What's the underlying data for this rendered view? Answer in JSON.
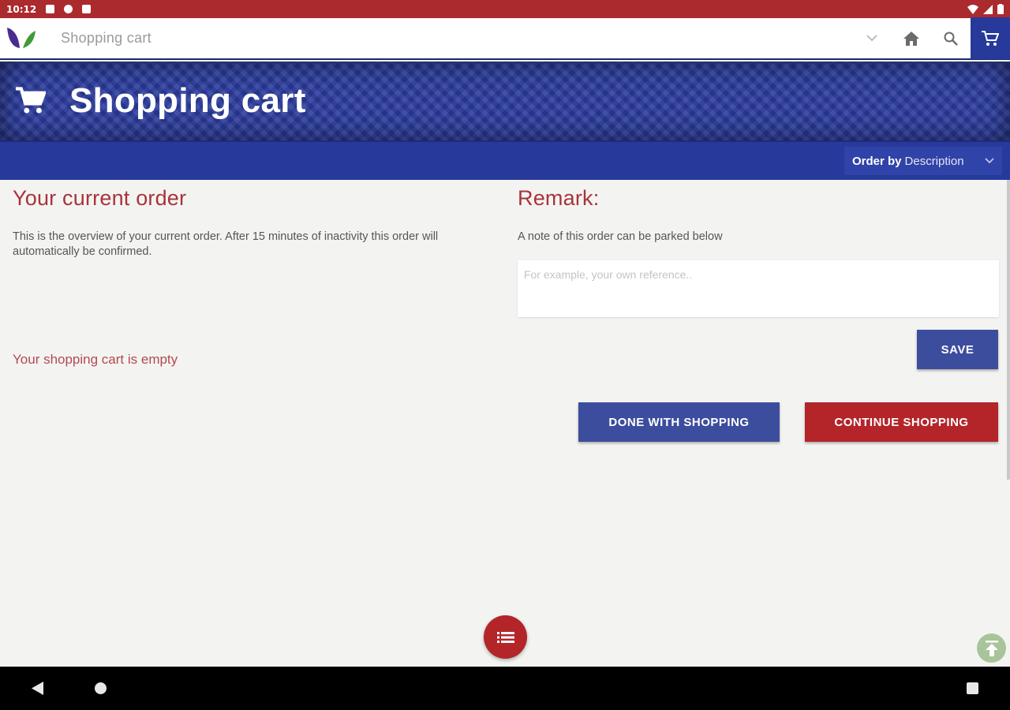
{
  "status_bar": {
    "time": "10:12"
  },
  "app_bar": {
    "title": "Shopping cart",
    "icons": [
      "leaf-logo",
      "chevron-down-icon",
      "home-icon",
      "search-icon",
      "cart-icon"
    ]
  },
  "hero": {
    "title": "Shopping cart",
    "icon": "cart-icon"
  },
  "order_by": {
    "label": "Order by",
    "value": "Description"
  },
  "left": {
    "heading": "Your current order",
    "description": "This is the overview of your current order. After 15 minutes of inactivity this order will automatically be confirmed.",
    "empty_message": "Your shopping cart is empty"
  },
  "right": {
    "heading": "Remark:",
    "description": "A note of this order can be parked below",
    "remark_placeholder": "For example, your own reference..",
    "save_label": "SAVE"
  },
  "actions": {
    "done_label": "DONE WITH SHOPPING",
    "continue_label": "CONTINUE SHOPPING"
  },
  "colors": {
    "brand_red": "#ab2a2e",
    "brand_blue": "#27399a",
    "button_blue": "#3d4d9e",
    "button_red": "#b32529"
  }
}
